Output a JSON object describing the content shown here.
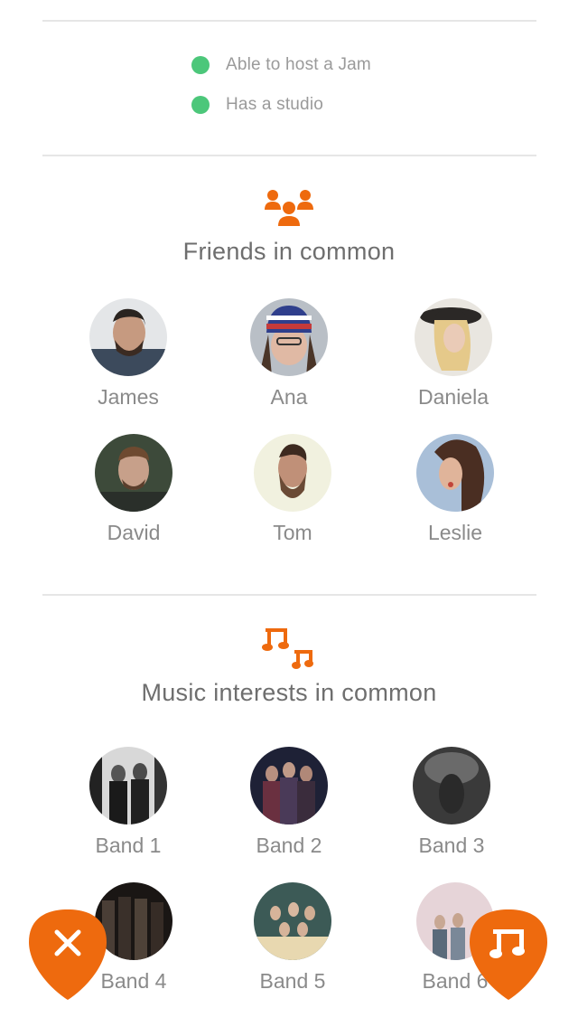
{
  "attributes": [
    {
      "label": "Able to host a Jam"
    },
    {
      "label": "Has a studio"
    }
  ],
  "friends_section": {
    "title": "Friends in common",
    "icon": "group-of-people-icon",
    "friends": [
      {
        "name": "James"
      },
      {
        "name": "Ana"
      },
      {
        "name": "Daniela"
      },
      {
        "name": "David"
      },
      {
        "name": "Tom"
      },
      {
        "name": "Leslie"
      }
    ]
  },
  "music_section": {
    "title": "Music interests in common",
    "icon": "music-notes-icon",
    "bands": [
      {
        "name": "Band 1"
      },
      {
        "name": "Band 2"
      },
      {
        "name": "Band 3"
      },
      {
        "name": "Band 4"
      },
      {
        "name": "Band 5"
      },
      {
        "name": "Band 6"
      }
    ]
  },
  "actions": {
    "dismiss_icon": "close-icon",
    "jam_icon": "music-note-icon"
  },
  "colors": {
    "accent": "#ee6a0e",
    "status_green": "#4cc77a",
    "divider": "#e6e6e6"
  }
}
